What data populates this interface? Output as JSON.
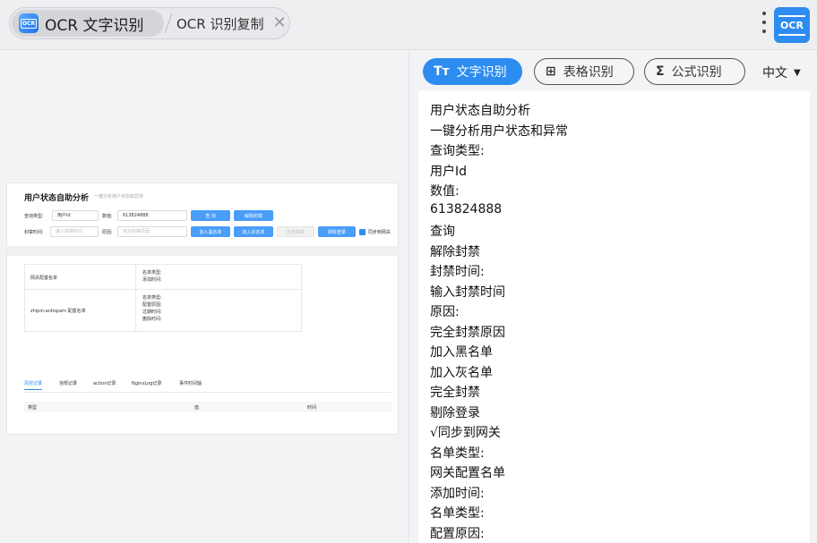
{
  "topbar": {
    "tab_active_label": "OCR 文字识别",
    "tab_second_label": "OCR 识别复制",
    "tab_close": "✕",
    "app_icon_text": "OCR",
    "ocr_button_label": "OCR"
  },
  "preview": {
    "title": "用户状态自助分析",
    "subtitle": "一键分析用户状态和异常",
    "query_type_label": "查询类型:",
    "query_type_value": "用户Id",
    "value_label": "数值:",
    "value_value": "613824888",
    "btn_query": "查 询",
    "btn_unban": "解除封禁",
    "ban_time_label": "封禁时间:",
    "ban_time_placeholder": "输入封禁时间",
    "reason_label": "原因:",
    "reason_placeholder": "完全封禁原因",
    "btn_blacklist": "加入黑名单",
    "btn_graylist": "加入灰名单",
    "btn_full_ban": "完全封禁",
    "btn_kick": "剔除登录",
    "sync_label": "同步到网关",
    "table": {
      "row1_name": "网关配置名单",
      "row1_fields": [
        "名单类型:",
        "添加时间:"
      ],
      "row2_name": "zhipin-antispam 配置名单",
      "row2_fields": [
        "名单类型:",
        "配置原因:",
        "过期时间:",
        "删除时间:"
      ]
    },
    "tabs": [
      "风控记录",
      "违规记录",
      "action记录",
      "NginxLog记录",
      "事件时间轴"
    ],
    "columns": [
      "类型",
      "值",
      "时间"
    ]
  },
  "modes": [
    {
      "icon": "Tт",
      "label": "文字识别",
      "active": true
    },
    {
      "icon": "⊞",
      "label": "表格识别",
      "active": false
    },
    {
      "icon": "Σ",
      "label": "公式识别",
      "active": false
    }
  ],
  "language": "中文",
  "result_lines": [
    "用户状态自助分析",
    "一键分析用户状态和异常",
    "查询类型:",
    "用户Id",
    "数值:",
    "613824888",
    "查询",
    "解除封禁",
    "封禁时间:",
    "输入封禁时间",
    "原因:",
    "完全封禁原因",
    "加入黑名单",
    "加入灰名单",
    "完全封禁",
    "剔除登录",
    "√同步到网关",
    "名单类型:",
    "网关配置名单",
    "添加时间:",
    "名单类型:",
    "配置原因:"
  ]
}
